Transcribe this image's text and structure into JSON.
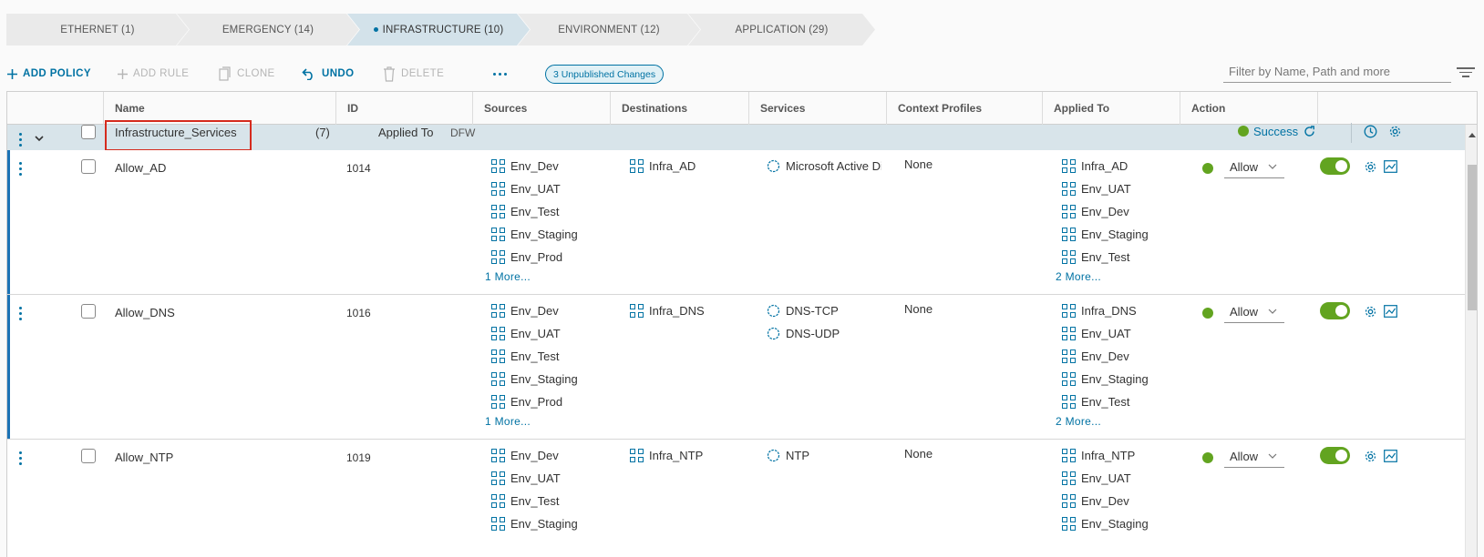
{
  "tabs": [
    {
      "label": "ETHERNET (1)",
      "active": false
    },
    {
      "label": "EMERGENCY (14)",
      "active": false
    },
    {
      "label": "INFRASTRUCTURE (10)",
      "active": true
    },
    {
      "label": "ENVIRONMENT (12)",
      "active": false
    },
    {
      "label": "APPLICATION (29)",
      "active": false
    }
  ],
  "toolbar": {
    "add_policy": "ADD POLICY",
    "add_rule": "ADD RULE",
    "clone": "CLONE",
    "undo": "UNDO",
    "delete": "DELETE",
    "unpublished": "3 Unpublished Changes",
    "filter_placeholder": "Filter by Name, Path and more"
  },
  "columns": [
    "Name",
    "ID",
    "Sources",
    "Destinations",
    "Services",
    "Context Profiles",
    "Applied To",
    "Action"
  ],
  "section": {
    "name": "Infrastructure_Services",
    "count": "(7)",
    "applied_to_label": "Applied To",
    "applied_to_value": "DFW",
    "status": "Success"
  },
  "rules": [
    {
      "name": "Allow_AD",
      "id": "1014",
      "sources": [
        "Env_Dev",
        "Env_UAT",
        "Env_Test",
        "Env_Staging",
        "Env_Prod"
      ],
      "sources_more": "1 More...",
      "destinations": [
        "Infra_AD"
      ],
      "services": [
        "Microsoft Active Dir"
      ],
      "context_profiles": "None",
      "applied_to": [
        "Infra_AD",
        "Env_UAT",
        "Env_Dev",
        "Env_Staging",
        "Env_Test"
      ],
      "applied_more": "2 More...",
      "action": "Allow"
    },
    {
      "name": "Allow_DNS",
      "id": "1016",
      "sources": [
        "Env_Dev",
        "Env_UAT",
        "Env_Test",
        "Env_Staging",
        "Env_Prod"
      ],
      "sources_more": "1 More...",
      "destinations": [
        "Infra_DNS"
      ],
      "services": [
        "DNS-TCP",
        "DNS-UDP"
      ],
      "context_profiles": "None",
      "applied_to": [
        "Infra_DNS",
        "Env_UAT",
        "Env_Dev",
        "Env_Staging",
        "Env_Test"
      ],
      "applied_more": "2 More...",
      "action": "Allow"
    },
    {
      "name": "Allow_NTP",
      "id": "1019",
      "sources": [
        "Env_Dev",
        "Env_UAT",
        "Env_Test",
        "Env_Staging"
      ],
      "sources_more": "",
      "destinations": [
        "Infra_NTP"
      ],
      "services": [
        "NTP"
      ],
      "context_profiles": "None",
      "applied_to": [
        "Infra_NTP",
        "Env_UAT",
        "Env_Dev",
        "Env_Staging"
      ],
      "applied_more": "",
      "action": "Allow"
    }
  ],
  "colors": {
    "accent": "#0072a3",
    "success": "#62a420",
    "section_bg": "#d8e4ea",
    "highlight": "#d52b1e"
  }
}
